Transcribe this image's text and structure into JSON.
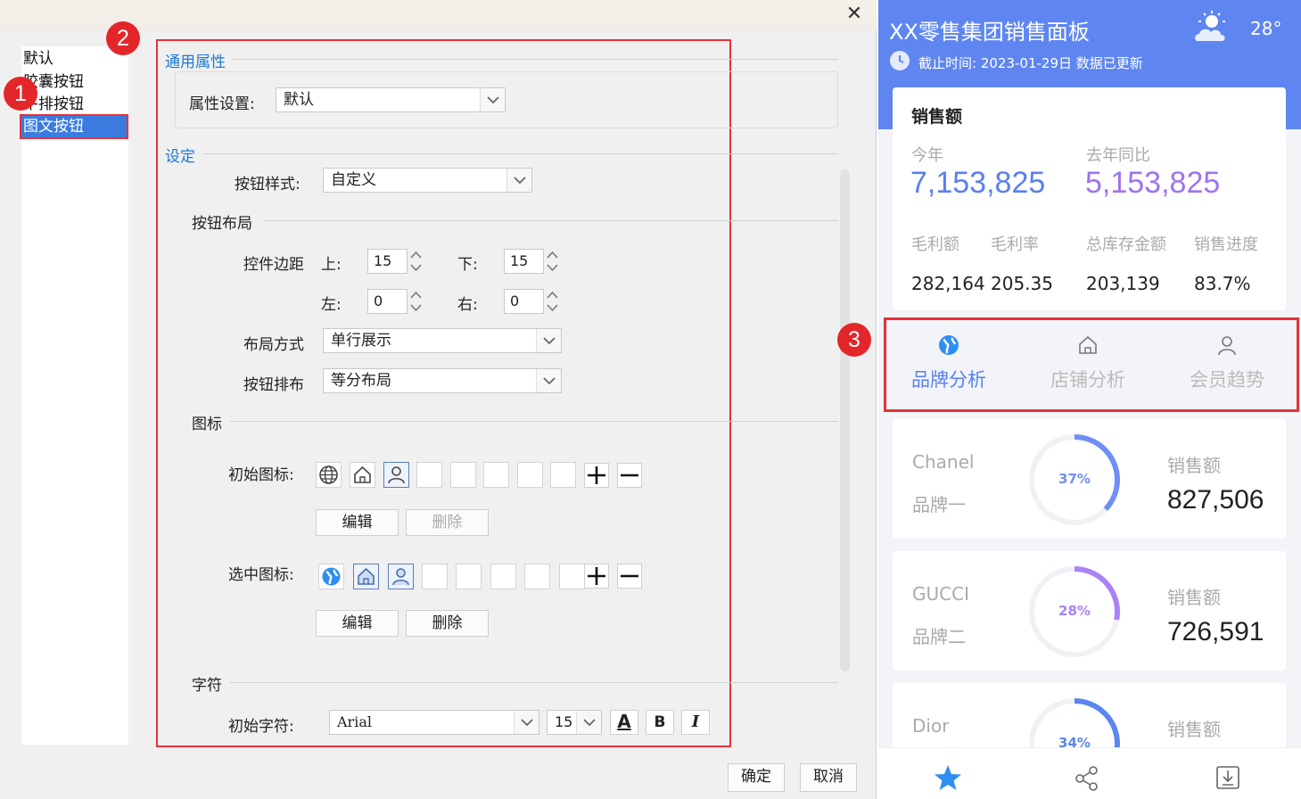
{
  "dialog": {
    "close_glyph": "✕",
    "type_list": [
      "默认",
      "胶囊按钮",
      "平排按钮",
      "图文按钮"
    ],
    "badges": [
      "1",
      "2",
      "3"
    ],
    "general": {
      "title": "通用属性",
      "prop_label": "属性设置:",
      "prop_value": "默认"
    },
    "settings": {
      "title": "设定",
      "style_label": "按钮样式:",
      "style_value": "自定义",
      "layout_group": "按钮布局",
      "margin_label": "控件边距",
      "top_label": "上:",
      "top_value": "15",
      "bottom_label": "下:",
      "bottom_value": "15",
      "left_label": "左:",
      "left_value": "0",
      "right_label": "右:",
      "right_value": "0",
      "layout_mode_label": "布局方式",
      "layout_mode_value": "单行展示",
      "arrange_label": "按钮排布",
      "arrange_value": "等分布局"
    },
    "icons": {
      "group": "图标",
      "initial_label": "初始图标:",
      "selected_label": "选中图标:",
      "edit": "编辑",
      "delete": "删除"
    },
    "chars": {
      "group": "字符",
      "initial_label": "初始字符:",
      "font": "Arial",
      "size": "15",
      "color_glyph": "A",
      "bold": "B",
      "italic": "I"
    },
    "ok": "确定",
    "cancel": "取消"
  },
  "mobile": {
    "title": "XX零售集团销售面板",
    "temp": "28°",
    "deadline": "截止时间: 2023-01-29日 数据已更新",
    "sales": {
      "title": "销售额",
      "this_year_label": "今年",
      "this_year": "7,153,825",
      "last_year_label": "去年同比",
      "last_year": "5,153,825",
      "metrics": [
        {
          "label": "毛利额",
          "value": "282,164"
        },
        {
          "label": "毛利率",
          "value": "205.35"
        },
        {
          "label": "总库存金额",
          "value": "203,139"
        },
        {
          "label": "销售进度",
          "value": "83.7%"
        }
      ]
    },
    "tabs": [
      "品牌分析",
      "店铺分析",
      "会员趋势"
    ],
    "brands": [
      {
        "name": "Chanel",
        "sub": "品牌一",
        "pct": "37%",
        "pct_value": 0.37,
        "label": "销售额",
        "value": "827,506",
        "color": "#6f8ff5"
      },
      {
        "name": "GUCCI",
        "sub": "品牌二",
        "pct": "28%",
        "pct_value": 0.28,
        "label": "销售额",
        "value": "726,591",
        "color": "#a983f5"
      },
      {
        "name": "Dior",
        "sub": "",
        "pct": "34%",
        "pct_value": 0.34,
        "label": "销售额",
        "value": "",
        "color": "#5b85ef"
      }
    ]
  }
}
